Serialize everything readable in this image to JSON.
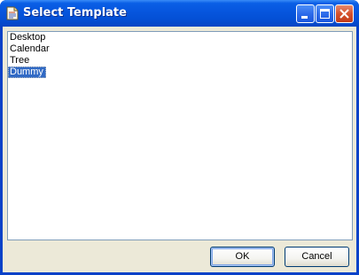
{
  "window": {
    "title": "Select Template",
    "icons": {
      "app": "document-icon",
      "minimize": "minimize-icon",
      "maximize": "maximize-icon",
      "close": "close-icon"
    }
  },
  "template_list": {
    "items": [
      "Desktop",
      "Calendar",
      "Tree",
      "Dummy"
    ],
    "selected_index": 3
  },
  "buttons": {
    "ok_label": "OK",
    "cancel_label": "Cancel"
  },
  "colors": {
    "titlebar": "#0655dd",
    "selection": "#316ac5",
    "close_button": "#d5512d",
    "dialog_face": "#ece9d8"
  }
}
